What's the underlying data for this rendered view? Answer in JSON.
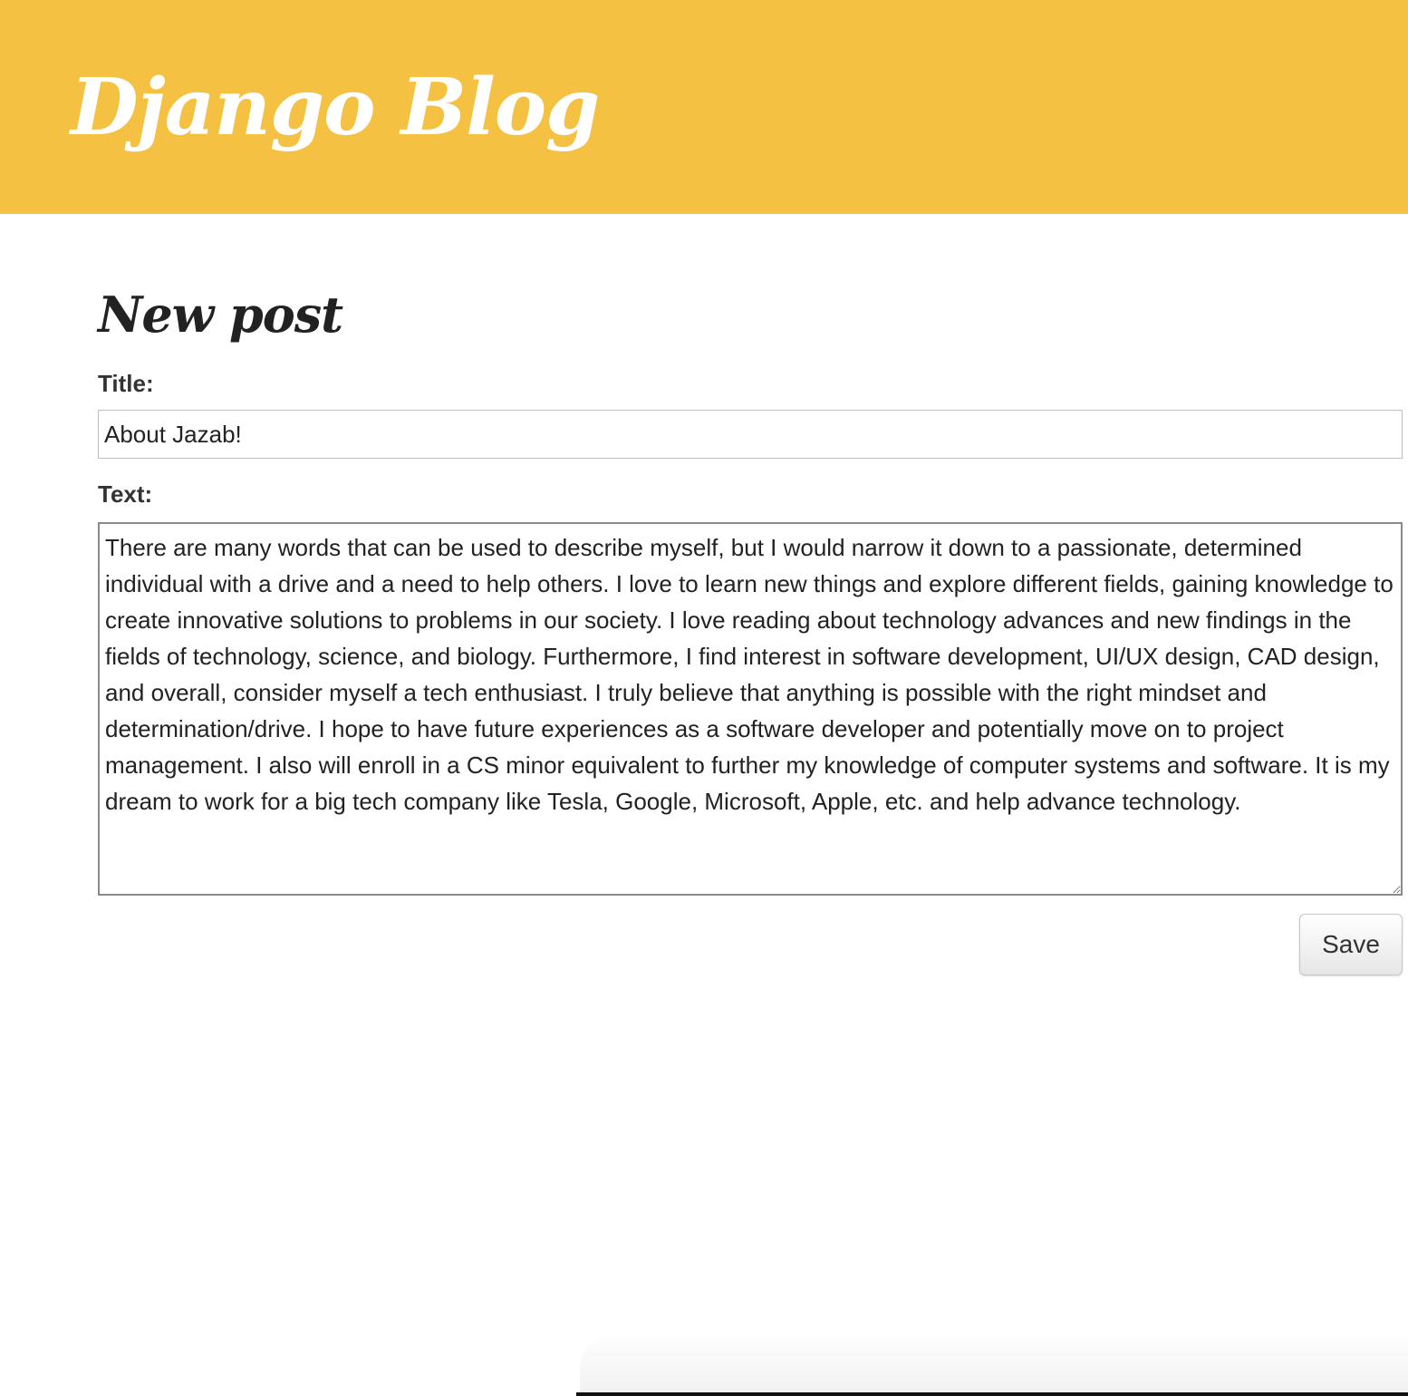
{
  "header": {
    "site_title": "Django Blog",
    "background_color": "#f5c142"
  },
  "main": {
    "page_title": "New post",
    "form": {
      "title_label": "Title:",
      "title_value": "About Jazab!",
      "text_label": "Text:",
      "text_value": "There are many words that can be used to describe myself, but I would narrow it down to a passionate, determined individual with a drive and a need to help others. I love to learn new things and explore different fields, gaining knowledge to create innovative solutions to problems in our society. I love reading about technology advances and new findings in the fields of technology, science, and biology. Furthermore, I find interest in software development, UI/UX design, CAD design, and overall, consider myself a tech enthusiast. I truly believe that anything is possible with the right mindset and determination/drive. I hope to have future experiences as a software developer and potentially move on to project management. I also will enroll in a CS minor equivalent to further my knowledge of computer systems and software. It is my dream to work for a big tech company like Tesla, Google, Microsoft, Apple, etc. and help advance technology.",
      "save_label": "Save"
    }
  }
}
